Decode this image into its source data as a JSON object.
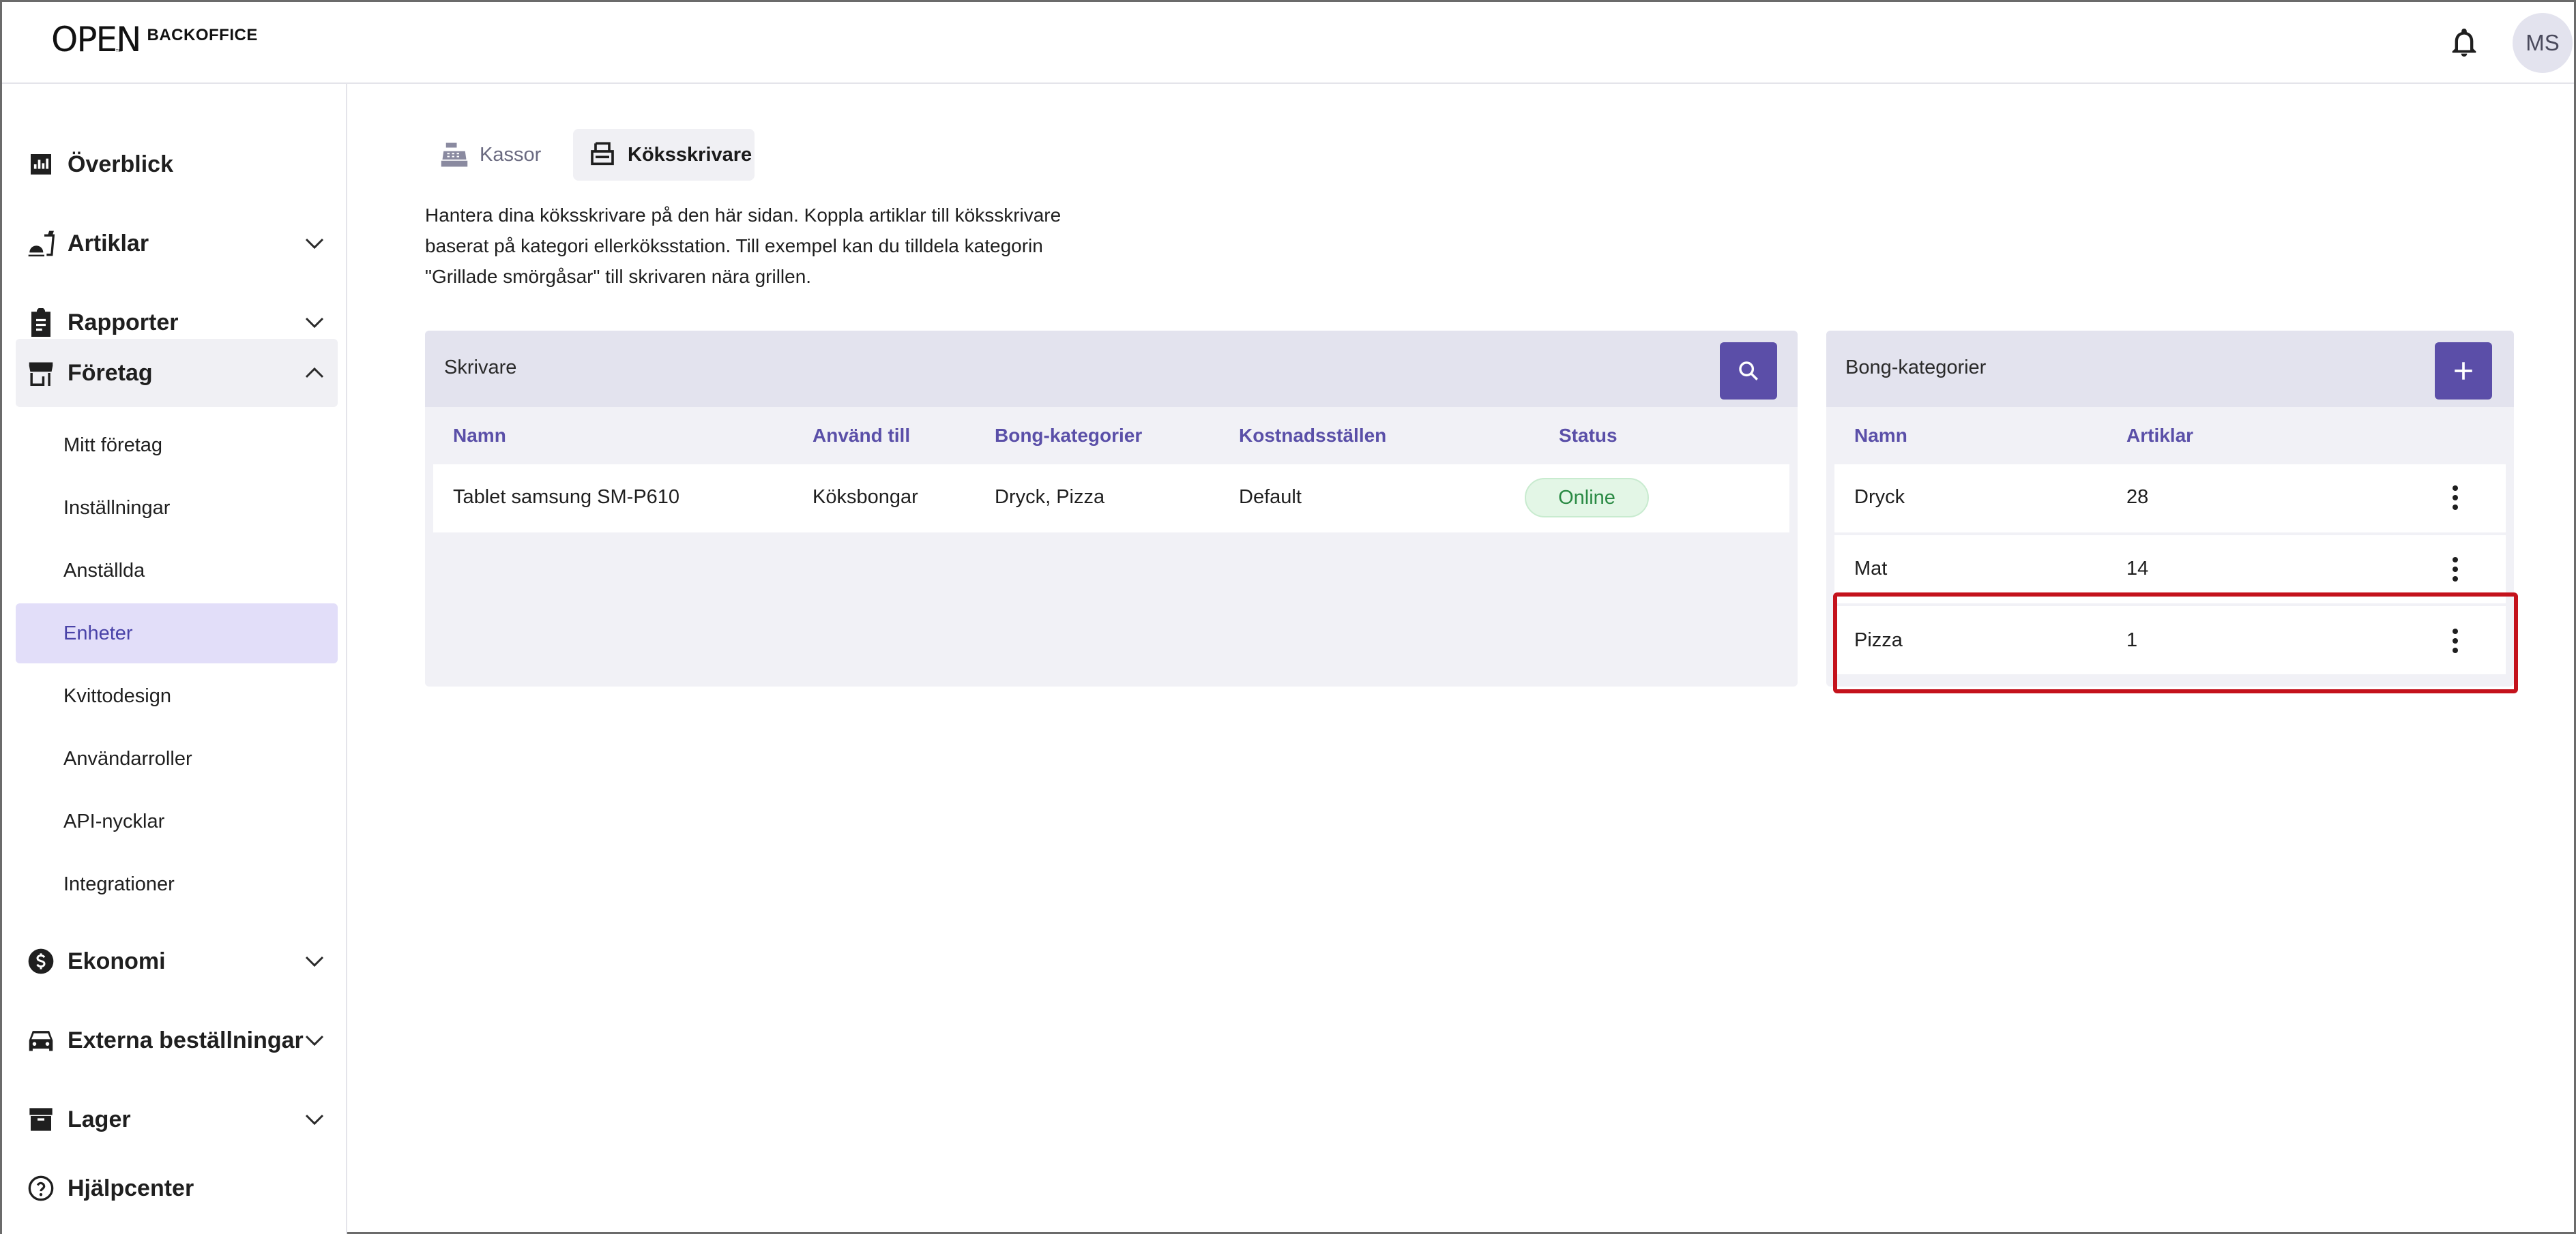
{
  "header": {
    "logo_mark": "OPEN",
    "logo_tm": "™",
    "logo_word": "BACKOFFICE",
    "avatar_initials": "MS"
  },
  "sidebar": {
    "items": [
      {
        "label": "Överblick",
        "icon": "chart-icon"
      },
      {
        "label": "Artiklar",
        "icon": "food-icon"
      },
      {
        "label": "Rapporter",
        "icon": "clipboard-icon"
      },
      {
        "label": "Företag",
        "icon": "store-icon"
      },
      {
        "label": "Ekonomi",
        "icon": "dollar-icon"
      },
      {
        "label": "Externa beställningar",
        "icon": "car-icon"
      },
      {
        "label": "Lager",
        "icon": "archive-icon"
      },
      {
        "label": "Hjälpcenter",
        "icon": "help-icon"
      }
    ],
    "subitems": [
      {
        "label": "Mitt företag"
      },
      {
        "label": "Inställningar"
      },
      {
        "label": "Anställda"
      },
      {
        "label": "Enheter"
      },
      {
        "label": "Kvittodesign"
      },
      {
        "label": "Användarroller"
      },
      {
        "label": "API-nycklar"
      },
      {
        "label": "Integrationer"
      }
    ]
  },
  "tabs": [
    {
      "label": "Kassor",
      "icon": "cash-register-icon"
    },
    {
      "label": "Köksskrivare",
      "icon": "printer-icon"
    }
  ],
  "description": "Hantera dina köksskrivare på den här sidan. Koppla artiklar till köksskrivare baserat på kategori ellerköksstation. Till exempel kan du tilldela kategorin \"Grillade smörgåsar\" till skrivaren nära grillen.",
  "printers": {
    "title": "Skrivare",
    "columns": [
      "Namn",
      "Använd till",
      "Bong-kategorier",
      "Kostnadsställen",
      "Status"
    ],
    "rows": [
      {
        "name": "Tablet samsung SM-P610",
        "use": "Köksbongar",
        "categories": "Dryck, Pizza",
        "cost_center": "Default",
        "status": "Online"
      }
    ]
  },
  "categories": {
    "title": "Bong-kategorier",
    "columns": [
      "Namn",
      "Artiklar"
    ],
    "rows": [
      {
        "name": "Dryck",
        "count": "28"
      },
      {
        "name": "Mat",
        "count": "14"
      },
      {
        "name": "Pizza",
        "count": "1"
      }
    ]
  },
  "colors": {
    "accent": "#5b4ea8",
    "active_bg": "#e2def9",
    "online_green": "#2a8a44",
    "highlight_red": "#c4121c"
  }
}
